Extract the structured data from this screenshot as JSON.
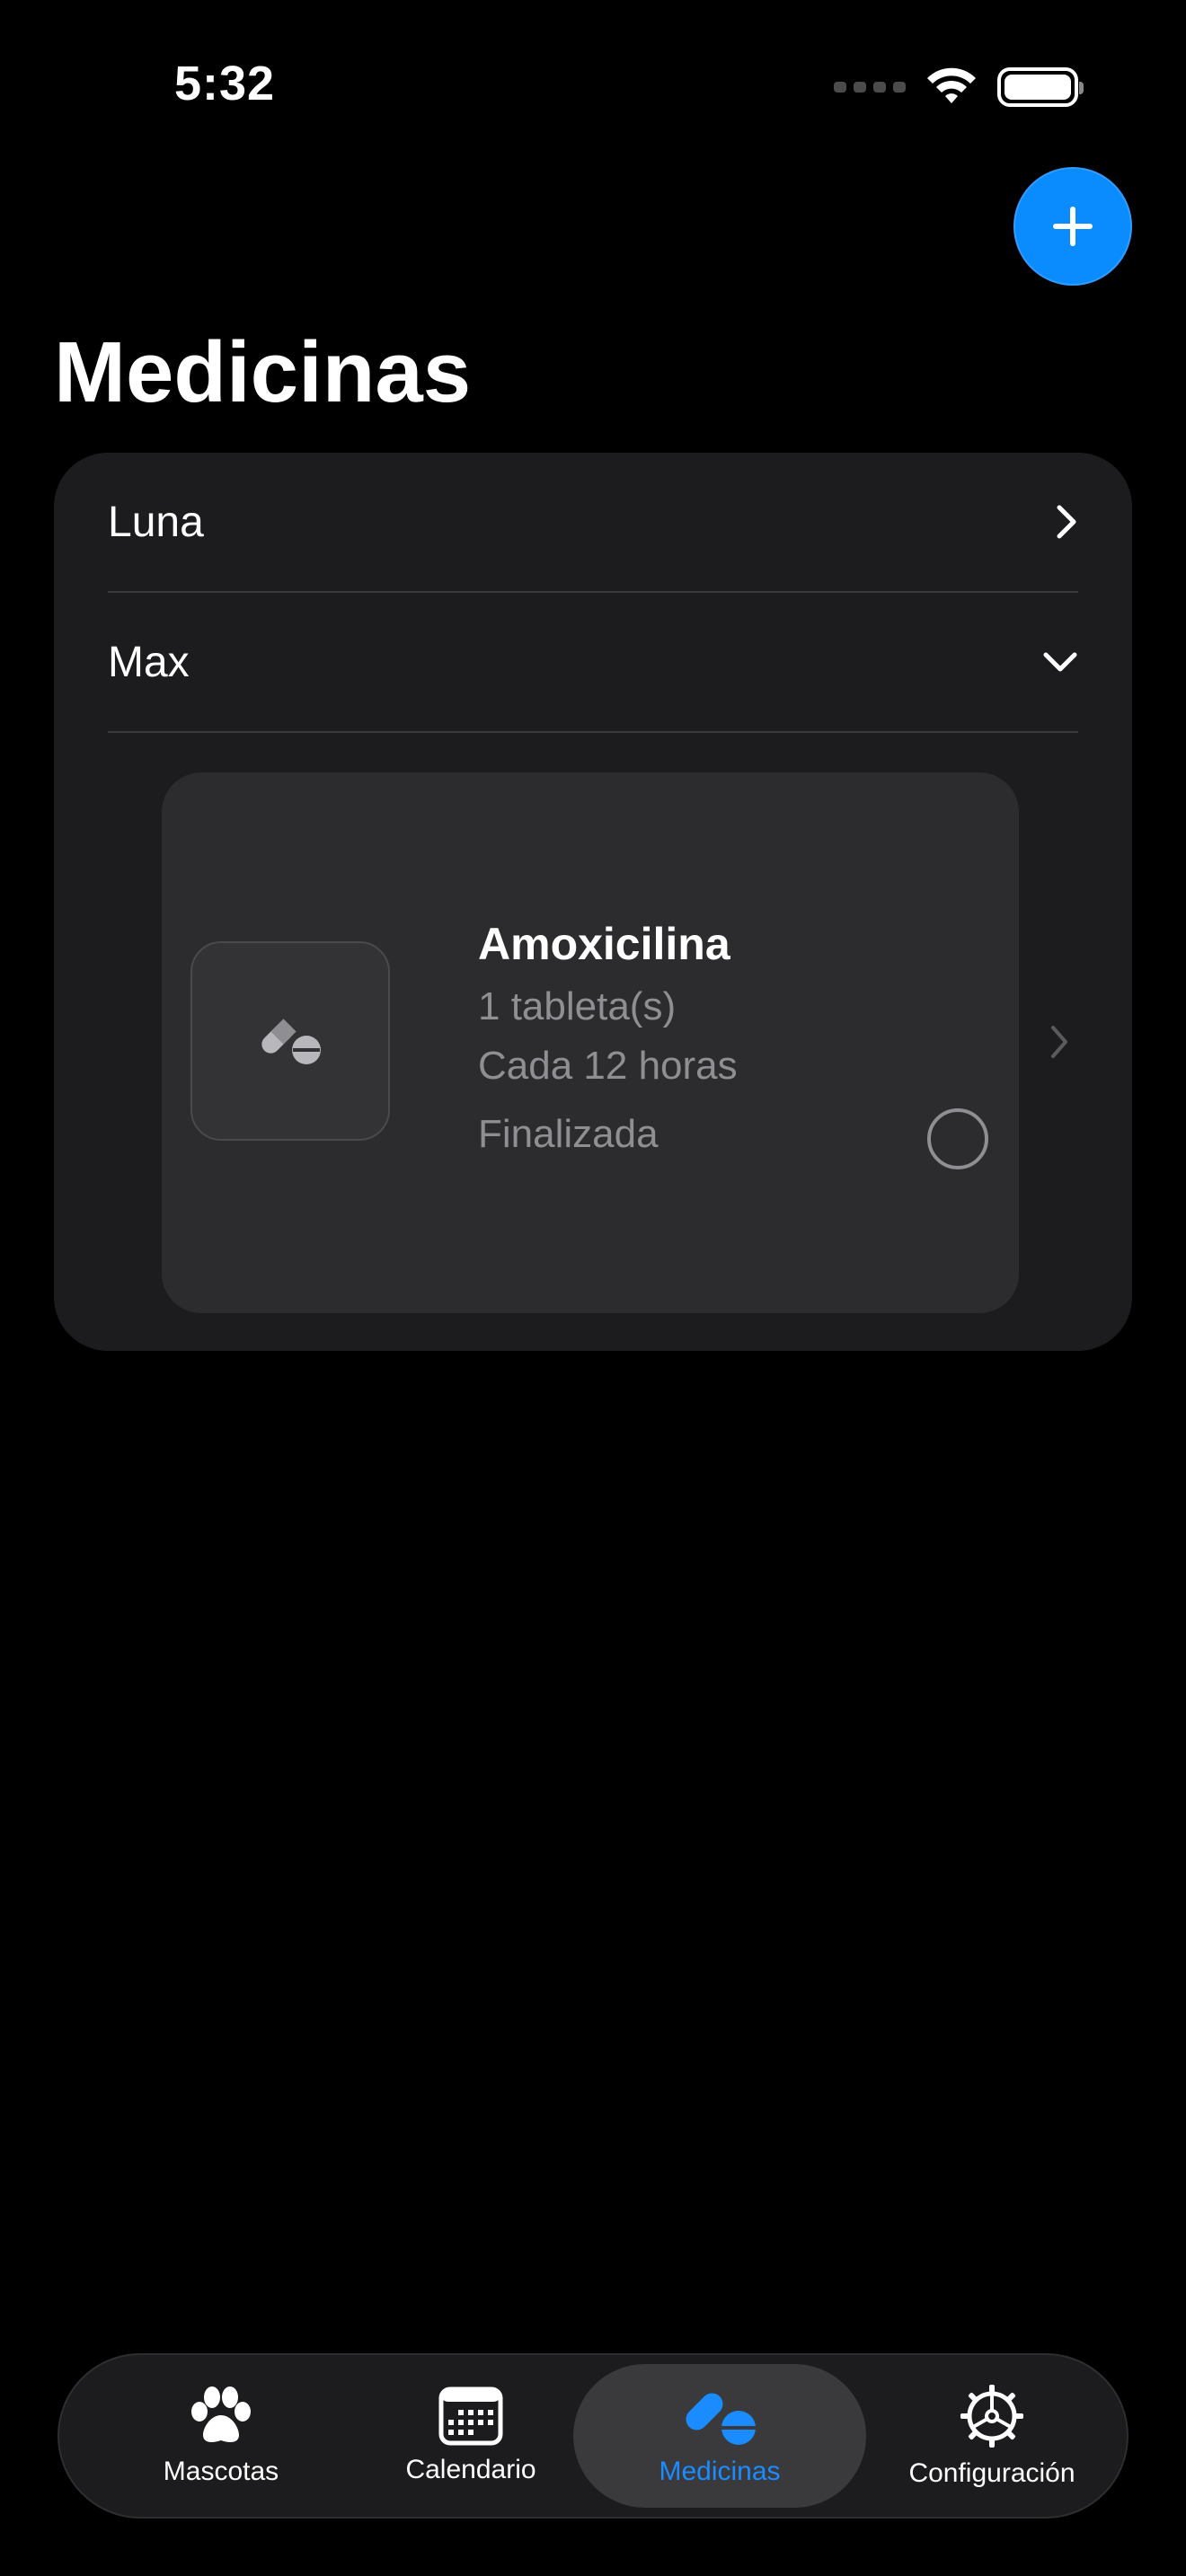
{
  "status_bar": {
    "time": "5:32"
  },
  "header": {
    "title": "Medicinas"
  },
  "pets": [
    {
      "name": "Luna",
      "expanded": false
    },
    {
      "name": "Max",
      "expanded": true
    }
  ],
  "medicine": {
    "name": "Amoxicilina",
    "dose": "1 tableta(s)",
    "frequency": "Cada 12 horas",
    "status": "Finalizada"
  },
  "tabs": [
    {
      "label": "Mascotas",
      "icon": "paw-icon",
      "active": false
    },
    {
      "label": "Calendario",
      "icon": "calendar-icon",
      "active": false
    },
    {
      "label": "Medicinas",
      "icon": "pills-icon",
      "active": true
    },
    {
      "label": "Configuración",
      "icon": "gear-icon",
      "active": false
    }
  ],
  "colors": {
    "accent": "#0a8cff",
    "background": "#000000",
    "card": "#1c1c1e",
    "secondary_text": "#8e8e93"
  }
}
